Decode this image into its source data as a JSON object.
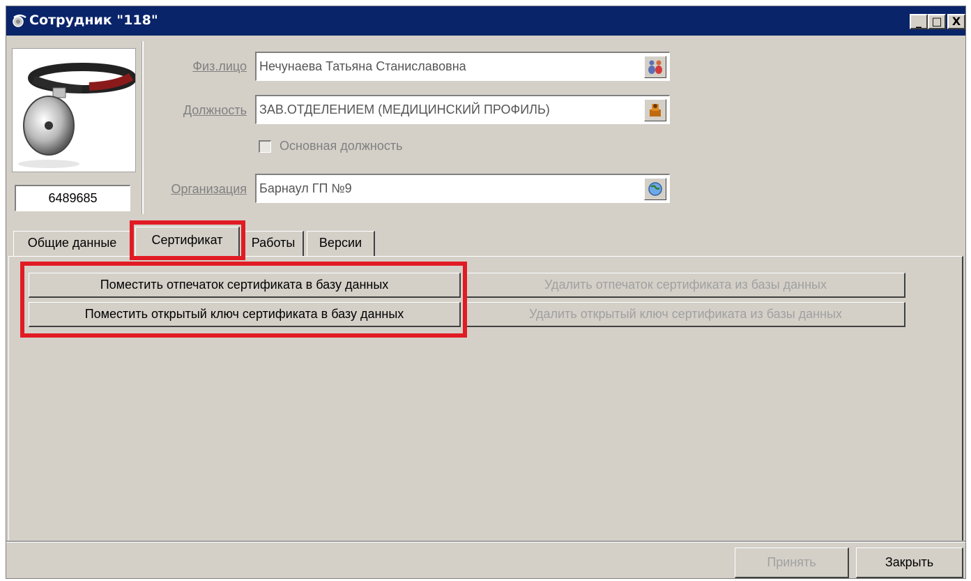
{
  "window": {
    "title": "Сотрудник \"118\"",
    "minimize": "_",
    "maximize": "□",
    "close": "X"
  },
  "employee": {
    "id": "6489685"
  },
  "fields": {
    "person": {
      "label": "Физ.лицо",
      "value": "Нечунаева Татьяна Станиславовна"
    },
    "position": {
      "label": "Должность",
      "value": "ЗАВ.ОТДЕЛЕНИЕМ (МЕДИЦИНСКИЙ ПРОФИЛЬ)"
    },
    "main_position": {
      "label": "Основная должность",
      "checked": false
    },
    "organization": {
      "label": "Организация",
      "value": "Барнаул ГП №9"
    }
  },
  "tabs": [
    {
      "label": "Общие данные",
      "active": false
    },
    {
      "label": "Сертификат",
      "active": true
    },
    {
      "label": "Работы",
      "active": false
    },
    {
      "label": "Версии",
      "active": false
    }
  ],
  "certificate": {
    "put_fingerprint": "Поместить отпечаток сертификата в базу данных",
    "put_public_key": "Поместить открытый ключ сертификата в базу данных",
    "delete_fingerprint": "Удалить отпечаток сертификата из базы данных",
    "delete_public_key": "Удалить открытый ключ сертификата из базы данных"
  },
  "footer": {
    "accept": "Принять",
    "close": "Закрыть"
  },
  "colors": {
    "title_bar": "#0a246a",
    "window_bg": "#d4d0c8",
    "highlight": "#e11b24"
  }
}
